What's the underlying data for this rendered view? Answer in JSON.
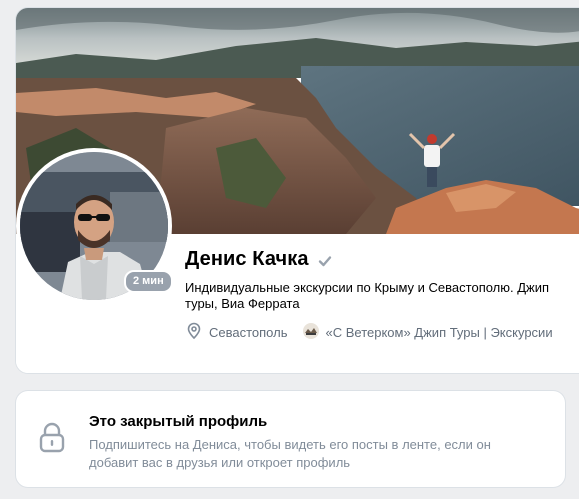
{
  "profile": {
    "name": "Денис Качка",
    "online_badge": "2 мин",
    "status": "Индивидуальные экскурсии по Крыму и Севастополю. Джип туры, Виа Феррата",
    "city": "Севастополь",
    "work": "«С Ветерком» Джип Туры | Экскурсии"
  },
  "private_notice": {
    "title": "Это закрытый профиль",
    "text": "Подпишитесь на Дениса, чтобы видеть его посты в ленте, если он добавит вас в друзья или откроет профиль"
  },
  "colors": {
    "background": "#edeef0",
    "card": "#ffffff",
    "secondary_text": "#818c99",
    "badge": "#99a2ad"
  },
  "icons": {
    "verified": "verified-icon",
    "location": "location-pin-icon",
    "work": "company-logo-icon",
    "lock": "lock-icon"
  }
}
